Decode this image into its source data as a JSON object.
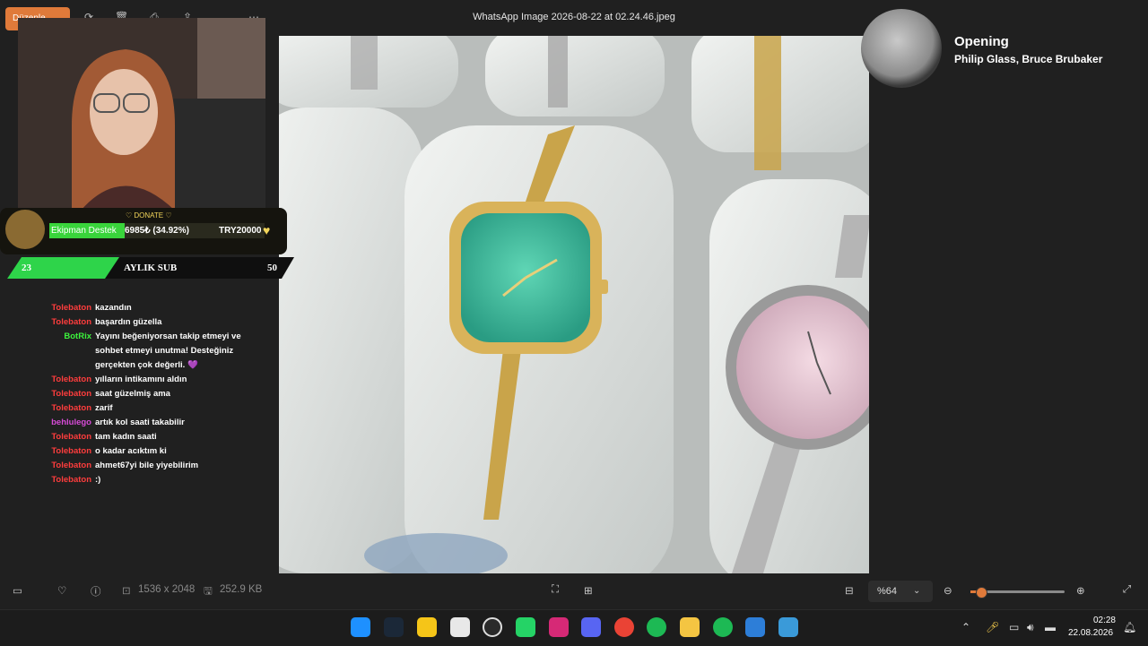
{
  "window": {
    "title": "WhatsApp Image 2026-08-22 at 02.24.46.jpeg",
    "edit_button": "Düzenle"
  },
  "donate": {
    "label": "♡ DONATE ♡",
    "bar_name": "Ekipman Destek",
    "bar_value": "6985₺ (34.92%)",
    "bar_goal": "TRY20000",
    "progress_percent": 34.92
  },
  "subs": {
    "left": "23",
    "title": "AYLIK SUB",
    "right": "50"
  },
  "chat": {
    "messages": [
      {
        "user": "Tolebaton",
        "color": "#ff3d3d",
        "text": "kazandın"
      },
      {
        "user": "Tolebaton",
        "color": "#ff3d3d",
        "text": "başardın güzella"
      },
      {
        "user": "BotRix",
        "color": "#3cf23c",
        "text": "Yayını beğeniyorsan takip etmeyi ve sohbet etmeyi unutma! Desteğiniz gerçekten çok değerli. 💜"
      },
      {
        "user": "Tolebaton",
        "color": "#ff3d3d",
        "text": "yılların intikamını aldın"
      },
      {
        "user": "Tolebaton",
        "color": "#ff3d3d",
        "text": "saat güzelmiş ama"
      },
      {
        "user": "Tolebaton",
        "color": "#ff3d3d",
        "text": "zarif"
      },
      {
        "user": "behlulego",
        "color": "#d74bd7",
        "text": "artık kol saati takabilir"
      },
      {
        "user": "Tolebaton",
        "color": "#ff3d3d",
        "text": "tam kadın saati"
      },
      {
        "user": "Tolebaton",
        "color": "#ff3d3d",
        "text": "o kadar acıktım ki"
      },
      {
        "user": "Tolebaton",
        "color": "#ff3d3d",
        "text": "ahmet67yi bile yiyebilirim"
      },
      {
        "user": "Tolebaton",
        "color": "#ff3d3d",
        "text": ":)"
      }
    ]
  },
  "now_playing": {
    "title": "Opening",
    "artist": "Philip Glass, Bruce Brubaker"
  },
  "bottom_bar": {
    "dimensions": "1536 x 2048",
    "file_size": "252.9 KB",
    "zoom": "%64"
  },
  "clock": {
    "time": "02:28",
    "date": "22.08.2026"
  },
  "taskbar_apps": [
    "windows-start",
    "steam",
    "sticky-notes",
    "snipping-tool",
    "obs",
    "whatsapp",
    "instagram",
    "discord",
    "chrome",
    "spotify",
    "file-explorer",
    "spotify",
    "vscode",
    "photos"
  ]
}
